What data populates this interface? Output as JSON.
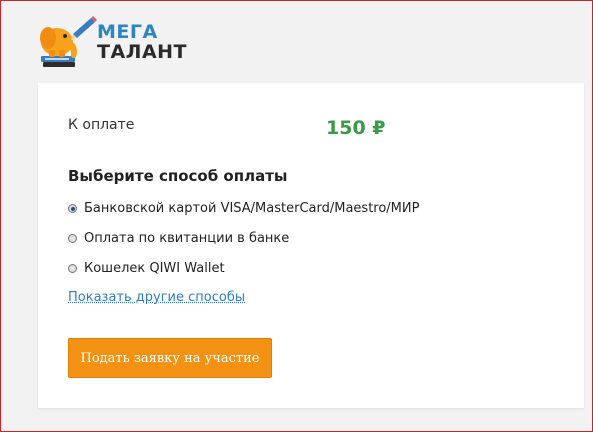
{
  "logo": {
    "line1": "МЕГА",
    "line2": "ТАЛАНТ"
  },
  "payment": {
    "amount_label": "К оплате",
    "amount_value": "150 ₽",
    "method_title": "Выберите способ оплаты",
    "options": [
      {
        "label": "Банковской картой VISA/MasterCard/Maestro/МИР",
        "selected": true
      },
      {
        "label": "Оплата по квитанции в банке",
        "selected": false
      },
      {
        "label": "Кошелек QIWI Wallet",
        "selected": false
      }
    ],
    "other_methods_link": "Показать другие способы",
    "submit_label": "Подать заявку на участие"
  },
  "colors": {
    "accent": "#f39212",
    "amount": "#3a9a46",
    "link": "#2f7dc4",
    "logo_blue": "#2e86c1"
  }
}
